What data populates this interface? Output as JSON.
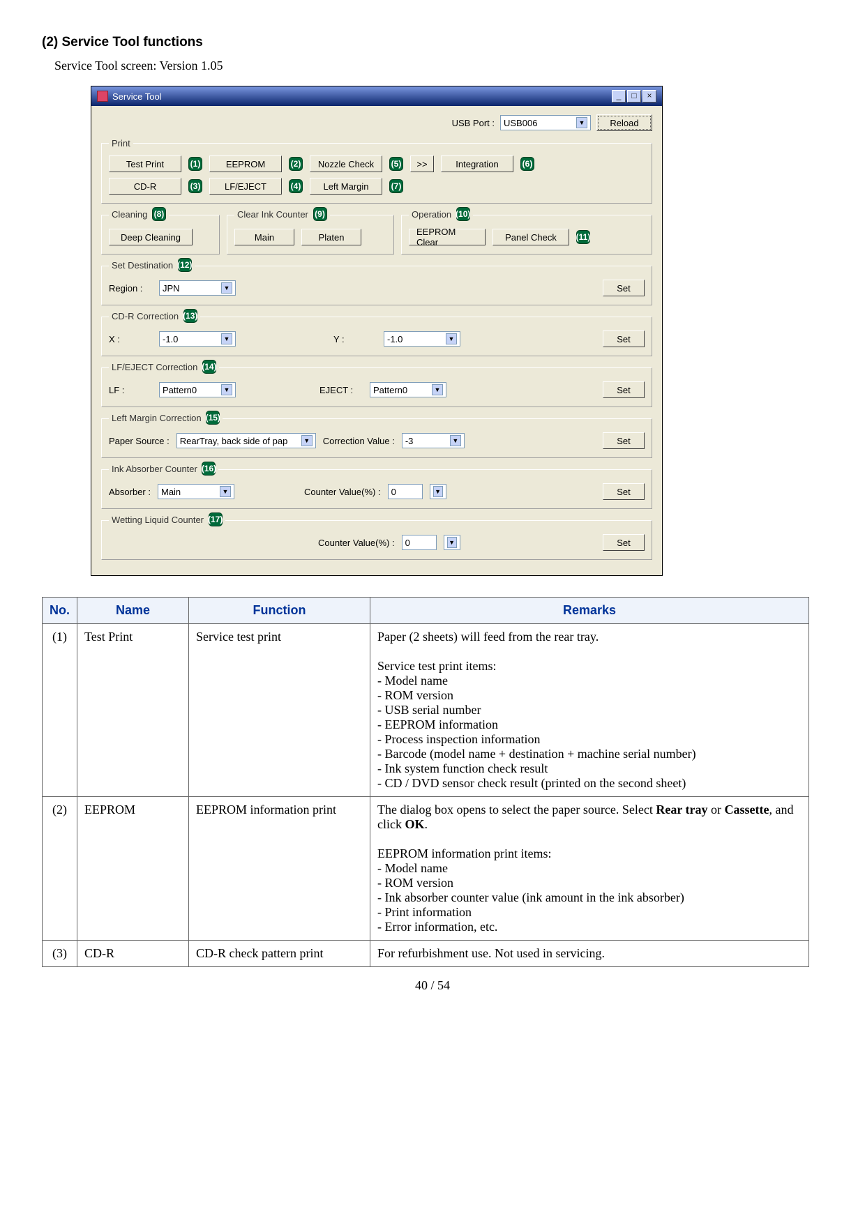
{
  "page": {
    "heading": "(2)  Service Tool functions",
    "subheading": "Service Tool screen:  Version 1.05",
    "pagenum": "40 / 54"
  },
  "app": {
    "title": "Service Tool",
    "usbPortLabel": "USB Port :",
    "usbPortValue": "USB006",
    "reload": "Reload",
    "print": {
      "legend": "Print",
      "testPrint": "Test Print",
      "eeprom": "EEPROM",
      "nozzle": "Nozzle Check",
      "arrows": ">>",
      "integration": "Integration",
      "cdr": "CD-R",
      "lfeject": "LF/EJECT",
      "leftMargin": "Left Margin",
      "c1": "(1)",
      "c2": "(2)",
      "c3": "(3)",
      "c4": "(4)",
      "c5": "(5)",
      "c6": "(6)",
      "c7": "(7)"
    },
    "cleaning": {
      "legend": "Cleaning",
      "c": "(8)",
      "deep": "Deep Cleaning"
    },
    "clearInk": {
      "legend": "Clear Ink Counter",
      "c": "(9)",
      "main": "Main",
      "platen": "Platen"
    },
    "operation": {
      "legend": "Operation",
      "c10": "(10)",
      "c11": "(11)",
      "eepromClear": "EEPROM Clear",
      "panel": "Panel Check"
    },
    "setDest": {
      "legend": "Set Destination",
      "c": "(12)",
      "regionLabel": "Region :",
      "regionValue": "JPN",
      "set": "Set"
    },
    "cdrc": {
      "legend": "CD-R Correction",
      "c": "(13)",
      "xLabel": "X :",
      "xValue": "-1.0",
      "yLabel": "Y :",
      "yValue": "-1.0",
      "set": "Set"
    },
    "lfe": {
      "legend": "LF/EJECT Correction",
      "c": "(14)",
      "lfLabel": "LF :",
      "lfValue": "Pattern0",
      "ejectLabel": "EJECT :",
      "ejectValue": "Pattern0",
      "set": "Set"
    },
    "lmc": {
      "legend": "Left Margin Correction",
      "c": "(15)",
      "paperLabel": "Paper Source :",
      "paperValue": "RearTray, back side of pap",
      "corrLabel": "Correction Value :",
      "corrValue": "-3",
      "set": "Set"
    },
    "ink": {
      "legend": "Ink Absorber Counter",
      "c": "(16)",
      "absLabel": "Absorber :",
      "absValue": "Main",
      "cvLabel": "Counter Value(%) :",
      "cvValue": "0",
      "set": "Set"
    },
    "wet": {
      "legend": "Wetting Liquid Counter",
      "c": "(17)",
      "cvLabel": "Counter Value(%) :",
      "cvValue": "0",
      "set": "Set"
    }
  },
  "table": {
    "headers": {
      "no": "No.",
      "name": "Name",
      "function": "Function",
      "remarks": "Remarks"
    },
    "rows": [
      {
        "no": "(1)",
        "name": "Test Print",
        "function": "Service test print",
        "remarks": "Paper (2 sheets) will feed from the rear tray.\n\nService test print items:\n- Model name\n- ROM version\n- USB serial number\n- EEPROM information\n- Process inspection information\n- Barcode (model name + destination + machine serial number)\n- Ink system function check result\n- CD / DVD sensor check result (printed on the second sheet)"
      },
      {
        "no": "(2)",
        "name": "EEPROM",
        "function": "EEPROM information print",
        "remarks": "The dialog box opens to select the paper source. Select Rear tray or Cassette, and click OK.\n\nEEPROM information print items:\n- Model name\n- ROM version\n- Ink absorber counter value (ink amount in the ink absorber)\n- Print information\n- Error information, etc."
      },
      {
        "no": "(3)",
        "name": "CD-R",
        "function": "CD-R check pattern print",
        "remarks": "For refurbishment use. Not used in servicing."
      }
    ]
  }
}
